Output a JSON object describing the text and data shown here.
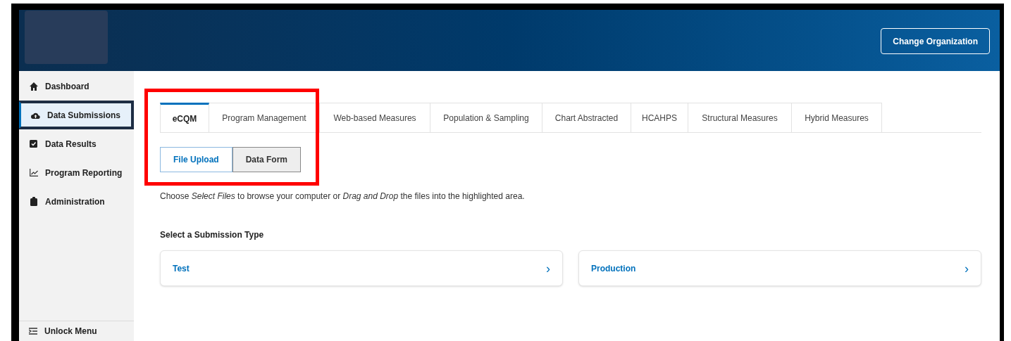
{
  "header": {
    "button": "Change Organization"
  },
  "sidebar": {
    "items": [
      {
        "label": "Dashboard",
        "selected": false
      },
      {
        "label": "Data Submissions",
        "selected": true
      },
      {
        "label": "Data Results",
        "selected": false
      },
      {
        "label": "Program Reporting",
        "selected": false
      },
      {
        "label": "Administration",
        "selected": false
      }
    ],
    "footer": {
      "label": "Unlock Menu"
    }
  },
  "tabs": [
    {
      "label": "eCQM",
      "selected": true
    },
    {
      "label": "Program Management",
      "selected": false
    },
    {
      "label": "Web-based Measures",
      "selected": false
    },
    {
      "label": "Population & Sampling",
      "selected": false
    },
    {
      "label": "Chart Abstracted",
      "selected": false
    },
    {
      "label": "HCAHPS",
      "selected": false
    },
    {
      "label": "Structural Measures",
      "selected": false
    },
    {
      "label": "Hybrid Measures",
      "selected": false
    }
  ],
  "mode_toggle": [
    {
      "label": "File Upload",
      "selected": true
    },
    {
      "label": "Data Form",
      "selected": false
    }
  ],
  "instructions": "Choose *Select Files* to browse your computer or *Drag and Drop* the files into the highlighted area.",
  "submission_type": {
    "heading": "Select a Submission Type",
    "options": [
      {
        "label": "Test",
        "icon": "›"
      },
      {
        "label": "Production",
        "icon": "›"
      }
    ]
  }
}
